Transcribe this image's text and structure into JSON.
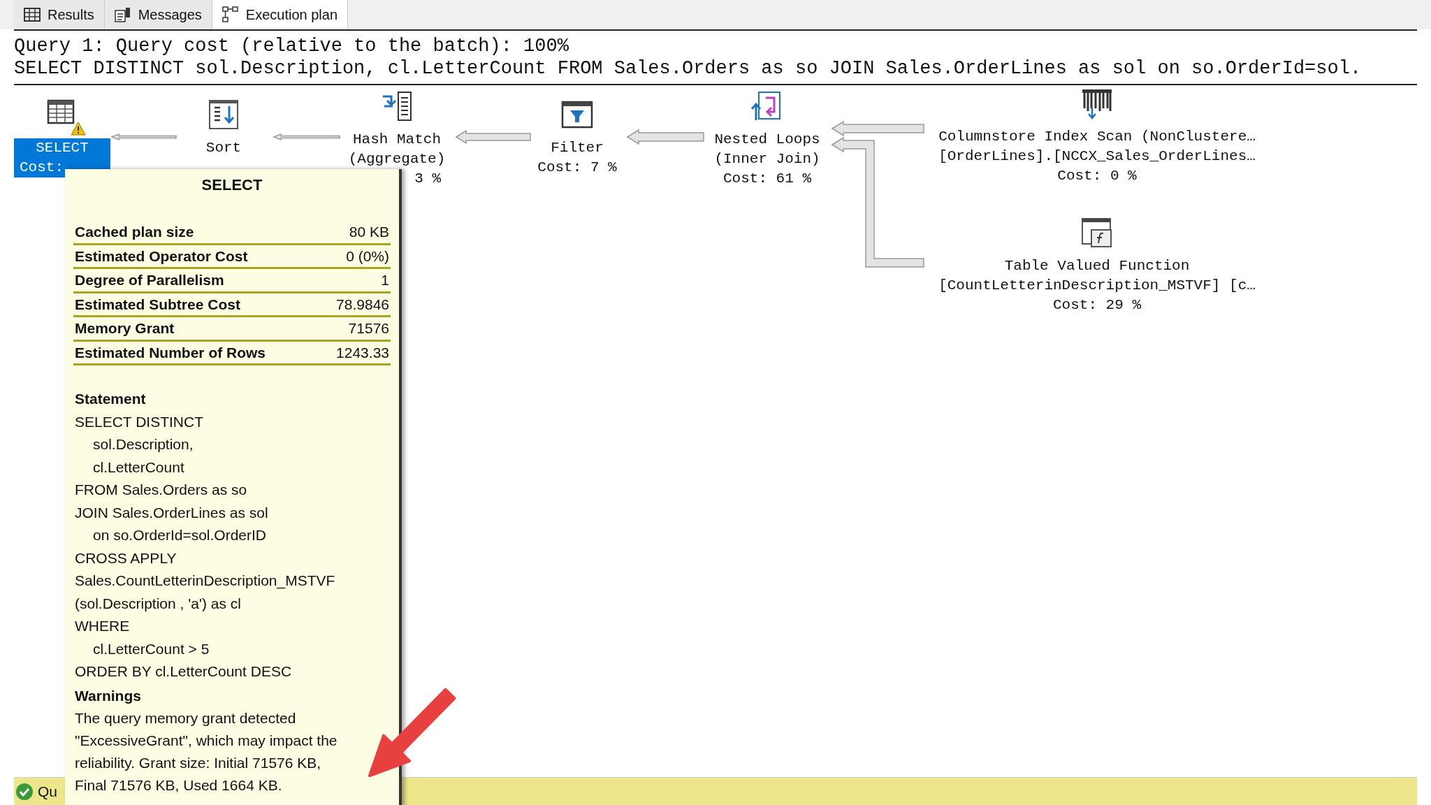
{
  "tabs": [
    {
      "label": "Results",
      "kind": "grid",
      "selected": false
    },
    {
      "label": "Messages",
      "kind": "messages",
      "selected": false
    },
    {
      "label": "Execution plan",
      "kind": "plan",
      "selected": true
    }
  ],
  "query": {
    "title": "Query 1: Query cost (relative to the batch): 100%",
    "statement": "SELECT DISTINCT sol.Description, cl.LetterCount FROM Sales.Orders as so JOIN Sales.OrderLines as sol on so.OrderId=sol."
  },
  "plan": {
    "nodes": [
      {
        "kind": "select",
        "lines": [
          "SELECT"
        ],
        "cost": "Cost:",
        "selected": true,
        "warning": true
      },
      {
        "kind": "sort",
        "lines": [
          "Sort"
        ],
        "selected": false,
        "warning": false
      },
      {
        "kind": "hash",
        "lines": [
          "Hash Match",
          "(Aggregate)"
        ],
        "cost": "3 %",
        "selected": false,
        "warning": false
      },
      {
        "kind": "filter",
        "lines": [
          "Filter"
        ],
        "cost": "Cost: 7 %",
        "selected": false,
        "warning": false
      },
      {
        "kind": "nested",
        "lines": [
          "Nested Loops",
          "(Inner Join)"
        ],
        "cost": "Cost: 61 %",
        "selected": false,
        "warning": false
      },
      {
        "kind": "columnstore",
        "lines": [
          "Columnstore Index Scan (NonClustere…",
          "[OrderLines].[NCCX_Sales_OrderLines…"
        ],
        "cost": "Cost: 0 %",
        "selected": false,
        "warning": false
      },
      {
        "kind": "tvf",
        "lines": [
          "Table Valued Function",
          "[CountLetterinDescription_MSTVF] [c…"
        ],
        "cost": "Cost: 29 %",
        "selected": false,
        "warning": false
      }
    ]
  },
  "tooltip": {
    "title": "SELECT",
    "properties": [
      {
        "label": "Cached plan size",
        "value": "80 KB"
      },
      {
        "label": "Estimated Operator Cost",
        "value": "0 (0%)"
      },
      {
        "label": "Degree of Parallelism",
        "value": "1"
      },
      {
        "label": "Estimated Subtree Cost",
        "value": "78.9846"
      },
      {
        "label": "Memory Grant",
        "value": "71576"
      },
      {
        "label": "Estimated Number of Rows",
        "value": "1243.33"
      }
    ],
    "statement_heading": "Statement",
    "statement_lines": [
      {
        "text": "SELECT DISTINCT",
        "children": [
          {
            "text": "sol.Description,"
          },
          {
            "text": "cl.LetterCount"
          }
        ]
      },
      {
        "text": "FROM Sales.Orders as so"
      },
      {
        "text": "JOIN Sales.OrderLines as sol",
        "children": [
          {
            "text": "on so.OrderId=sol.OrderID"
          }
        ]
      },
      {
        "text": "CROSS APPLY"
      },
      {
        "text": "Sales.CountLetterinDescription_MSTVF"
      },
      {
        "text": "(sol.Description , 'a') as cl"
      },
      {
        "text": "WHERE",
        "children": [
          {
            "text": "cl.LetterCount > 5"
          }
        ]
      },
      {
        "text": "ORDER BY cl.LetterCount DESC"
      }
    ],
    "warnings_heading": "Warnings",
    "warning_text": "The query memory grant detected \"ExcessiveGrant\", which may impact the reliability. Grant size: Initial 71576 KB, Final 71576 KB, Used 1664 KB."
  },
  "status_bar": {
    "text": "Qu",
    "ok": true
  }
}
